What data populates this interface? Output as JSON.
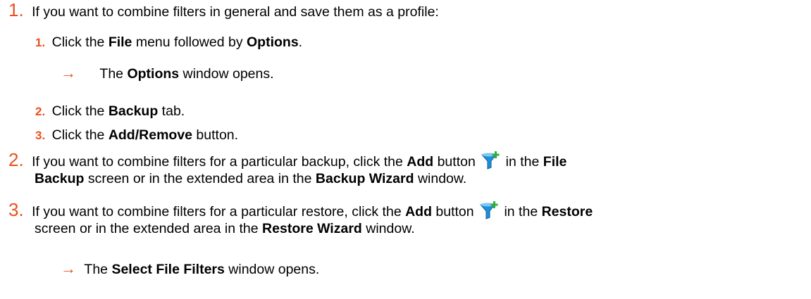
{
  "colors": {
    "accent": "#e8501e"
  },
  "steps": [
    {
      "num": "1.",
      "text": [
        "If you want to combine filters in general and save them as a profile:"
      ],
      "substeps": [
        {
          "num": "1.",
          "pre": "Click the ",
          "b1": "File",
          "mid": " menu followed by ",
          "b2": "Options",
          "post": "."
        },
        {
          "arrow": "→",
          "pre": "The ",
          "b1": "Options",
          "post": " window opens."
        },
        {
          "num": "2.",
          "pre": "Click the ",
          "b1": "Backup",
          "post": " tab."
        },
        {
          "num": "3.",
          "pre": "Click the ",
          "b1": "Add/Remove",
          "post": " button."
        }
      ]
    },
    {
      "num": "2.",
      "l1_pre": "If you want to combine filters for a particular backup, click the ",
      "l1_b1": "Add",
      "l1_mid": " button",
      "icon": "filter-add-icon",
      "l1_post": " in the ",
      "l1_b2": "File",
      "l2_b1": "Backup",
      "l2_mid": " screen or in the extended area in the ",
      "l2_b2": "Backup Wizard",
      "l2_post": " window."
    },
    {
      "num": "3.",
      "l1_pre": "If you want to combine filters for a particular restore, click the ",
      "l1_b1": "Add",
      "l1_mid": " button",
      "icon": "filter-add-icon",
      "l1_post": " in the ",
      "l1_b2": "Restore",
      "l2_pre": "screen or in the extended area in the ",
      "l2_b1": "Restore Wizard",
      "l2_post": " window."
    }
  ],
  "result": {
    "arrow": "→",
    "pre": "The ",
    "b1": "Select File Filters",
    "post": " window opens."
  }
}
